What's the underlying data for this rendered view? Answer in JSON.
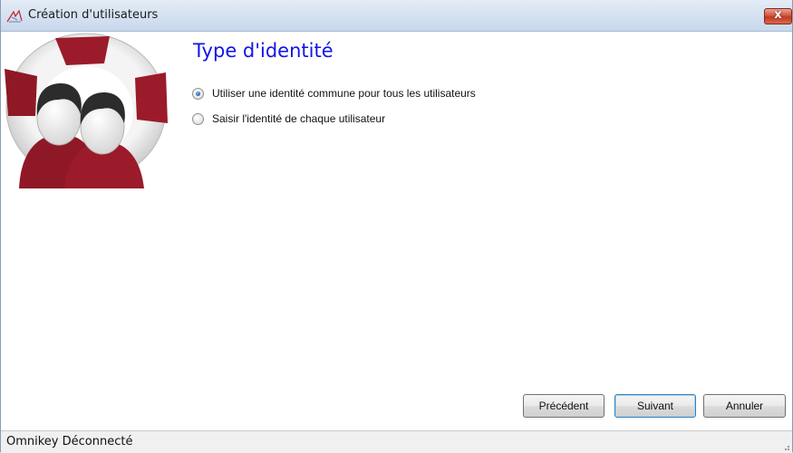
{
  "window": {
    "title": "Création d'utilisateurs",
    "close_glyph": "x"
  },
  "page": {
    "title": "Type d'identité"
  },
  "identity_options": [
    {
      "label": "Utiliser une identité commune pour tous les utilisateurs",
      "checked": true
    },
    {
      "label": "Saisir l'identité de chaque utilisateur",
      "checked": false
    }
  ],
  "buttons": {
    "previous": "Précédent",
    "next": "Suivant",
    "cancel": "Annuler"
  },
  "statusbar": {
    "text": "Omnikey Déconnecté"
  },
  "colors": {
    "title_blue": "#1414e8",
    "logo_red": "#9b1b2a",
    "close_red": "#c23a22"
  },
  "icons": [
    "app-icon",
    "lifebuoy-users-logo",
    "close-icon",
    "resize-grip-icon"
  ]
}
